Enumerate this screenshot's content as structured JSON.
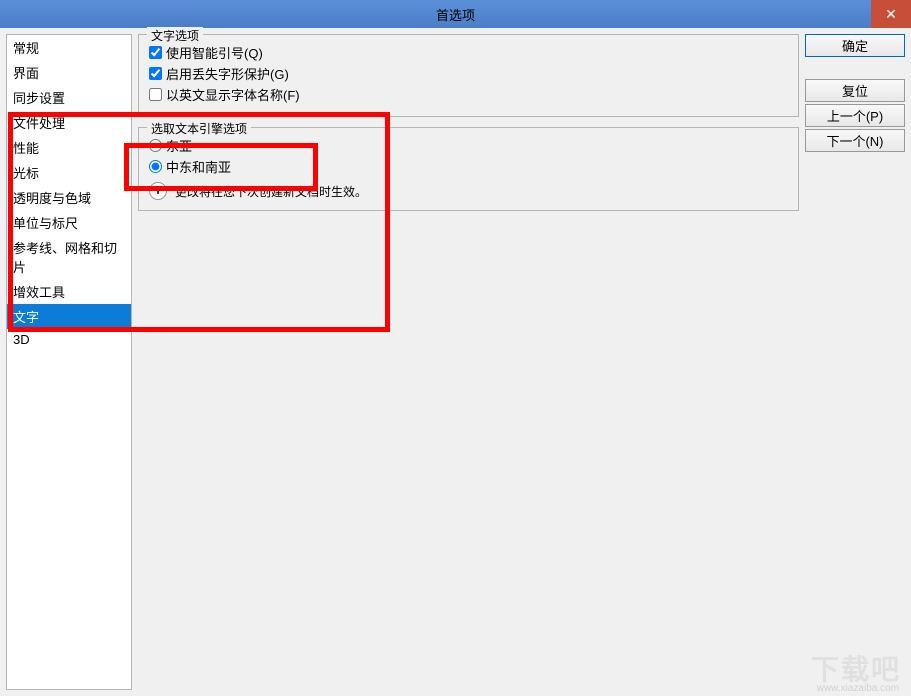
{
  "window": {
    "title": "首选项"
  },
  "sidebar": {
    "items": [
      {
        "label": "常规"
      },
      {
        "label": "界面"
      },
      {
        "label": "同步设置"
      },
      {
        "label": "文件处理"
      },
      {
        "label": "性能"
      },
      {
        "label": "光标"
      },
      {
        "label": "透明度与色域"
      },
      {
        "label": "单位与标尺"
      },
      {
        "label": "参考线、网格和切片"
      },
      {
        "label": "增效工具"
      },
      {
        "label": "文字"
      },
      {
        "label": "3D"
      }
    ]
  },
  "buttons": {
    "ok": "确定",
    "reset": "复位",
    "prev": "上一个(P)",
    "next": "下一个(N)"
  },
  "textOptions": {
    "legend": "文字选项",
    "smartQuotes": "使用智能引号(Q)",
    "missingGlyph": "启用丢失字形保护(G)",
    "englishFontNames": "以英文显示字体名称(F)"
  },
  "textEngine": {
    "legend": "选取文本引擎选项",
    "eastAsia": "东亚",
    "middleEastSouthAsia": "中东和南亚",
    "infoText": "更改将在您下次创建新文档时生效。"
  },
  "watermark": {
    "main": "下载吧",
    "sub": "www.xiazaiba.com"
  }
}
